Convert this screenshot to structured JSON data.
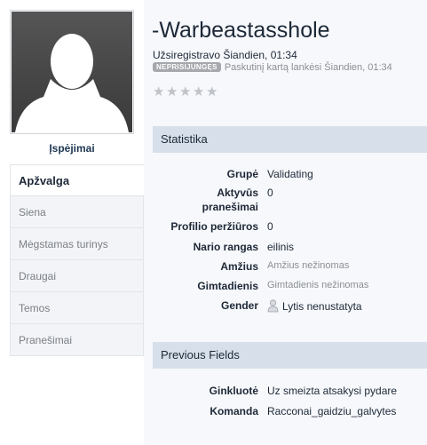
{
  "profile": {
    "username": "-Warbeastasshole",
    "joined": "Užsiregistravo Šiandien, 01:34",
    "status_badge": "NEPRISIJUNGĘS",
    "last_visit": "Paskutinį kartą lankėsi Šiandien, 01:34",
    "rating_stars": 5,
    "rating_filled": 0
  },
  "sidebar": {
    "warnings_link": "Įspėjimai",
    "items": [
      {
        "label": "Apžvalga"
      },
      {
        "label": "Siena"
      },
      {
        "label": "Mėgstamas turinys"
      },
      {
        "label": "Draugai"
      },
      {
        "label": "Temos"
      },
      {
        "label": "Pranešimai"
      }
    ]
  },
  "statistics": {
    "title": "Statistika",
    "rows": [
      {
        "label": "Grupė",
        "value": "Validating"
      },
      {
        "label": "Aktyvūs",
        "label2": "pranešimai",
        "value": "0"
      },
      {
        "label": "Profilio peržiūros",
        "value": "0"
      },
      {
        "label": "Nario rangas",
        "value": "eilinis"
      },
      {
        "label": "Amžius",
        "value": "Amžius nežinomas"
      },
      {
        "label": "Gimtadienis",
        "value": "Gimtadienis nežinomas"
      },
      {
        "label": "Gender",
        "value": "Lytis nenustatyta"
      }
    ]
  },
  "previous_fields": {
    "title": "Previous Fields",
    "rows": [
      {
        "label": "Ginkluotė",
        "value": "Uz smeizta atsakysi pydare"
      },
      {
        "label": "Komanda",
        "value": "Racconai_gaidziu_galvytes"
      }
    ]
  },
  "colors": {
    "section_header_bg": "#d7e0ea",
    "badge_bg": "#a5a8ad",
    "link": "#1d3652"
  },
  "icons": {
    "avatar": "default-avatar-silhouette",
    "star": "star-icon",
    "gender": "person-icon"
  }
}
